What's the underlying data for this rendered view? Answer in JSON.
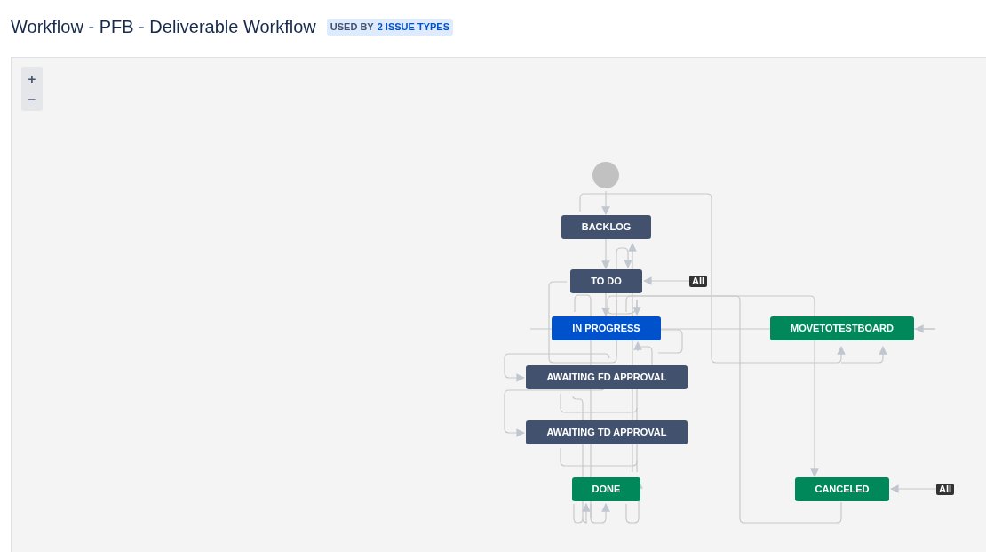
{
  "header": {
    "title": "Workflow - PFB - Deliverable Workflow",
    "badge": {
      "label": "USED BY",
      "link": "2 ISSUE TYPES"
    }
  },
  "zoom_controls": [
    "+",
    "−"
  ],
  "diagram": {
    "nodes": [
      {
        "label": "BACKLOG",
        "kind": "todo"
      },
      {
        "label": "TO DO",
        "kind": "todo"
      },
      {
        "label": "IN PROGRESS",
        "kind": "inprogress"
      },
      {
        "label": "MOVETOTESTBOARD",
        "kind": "done"
      },
      {
        "label": "AWAITING FD APPROVAL",
        "kind": "todo"
      },
      {
        "label": "AWAITING TD APPROVAL",
        "kind": "todo"
      },
      {
        "label": "DONE",
        "kind": "done"
      },
      {
        "label": "CANCELED",
        "kind": "done"
      }
    ],
    "global_transitions": [
      "All",
      "All"
    ]
  }
}
